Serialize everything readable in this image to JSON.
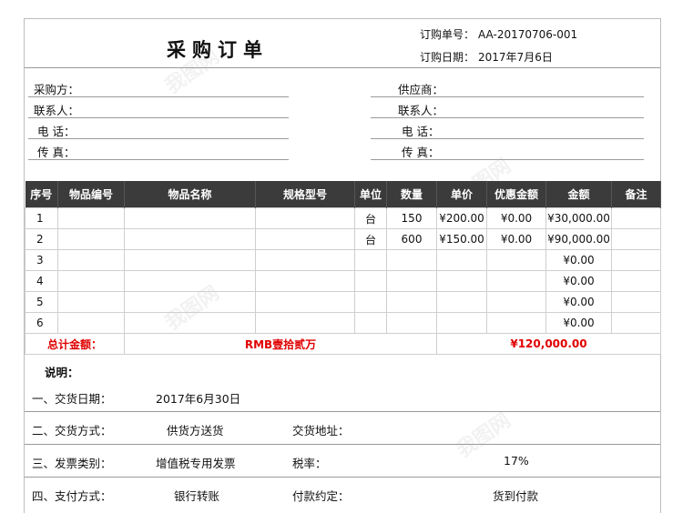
{
  "header": {
    "title": "采购订单",
    "order_no_label": "订购单号：",
    "order_no": "AA-20170706-001",
    "order_date_label": "订购日期：",
    "order_date": "2017年7月6日"
  },
  "parties": {
    "buyer_label": "采购方：",
    "buyer_contact_label": "联系人：",
    "buyer_phone_label": "电  话：",
    "buyer_fax_label": "传  真：",
    "supplier_label": "供应商：",
    "supplier_contact_label": "联系人：",
    "supplier_phone_label": "电  话：",
    "supplier_fax_label": "传  真："
  },
  "table": {
    "headers": [
      "序号",
      "物品编号",
      "物品名称",
      "规格型号",
      "单位",
      "数量",
      "单价",
      "优惠金额",
      "金额",
      "备注"
    ],
    "rows": [
      {
        "no": "1",
        "code": "",
        "name": "",
        "spec": "",
        "unit": "台",
        "qty": "150",
        "price": "¥200.00",
        "discount": "¥0.00",
        "amount": "¥30,000.00",
        "note": ""
      },
      {
        "no": "2",
        "code": "",
        "name": "",
        "spec": "",
        "unit": "台",
        "qty": "600",
        "price": "¥150.00",
        "discount": "¥0.00",
        "amount": "¥90,000.00",
        "note": ""
      },
      {
        "no": "3",
        "code": "",
        "name": "",
        "spec": "",
        "unit": "",
        "qty": "",
        "price": "",
        "discount": "",
        "amount": "¥0.00",
        "note": ""
      },
      {
        "no": "4",
        "code": "",
        "name": "",
        "spec": "",
        "unit": "",
        "qty": "",
        "price": "",
        "discount": "",
        "amount": "¥0.00",
        "note": ""
      },
      {
        "no": "5",
        "code": "",
        "name": "",
        "spec": "",
        "unit": "",
        "qty": "",
        "price": "",
        "discount": "",
        "amount": "¥0.00",
        "note": ""
      },
      {
        "no": "6",
        "code": "",
        "name": "",
        "spec": "",
        "unit": "",
        "qty": "",
        "price": "",
        "discount": "",
        "amount": "¥0.00",
        "note": ""
      }
    ],
    "total_label": "总计金额：",
    "total_words": "RMB壹拾贰万",
    "total_amount": "¥120,000.00"
  },
  "notes": {
    "title": "说明：",
    "delivery_date_label": "一、交货日期：",
    "delivery_date": "2017年6月30日",
    "delivery_method_label": "二、交货方式：",
    "delivery_method": "供货方送货",
    "delivery_address_label": "交货地址：",
    "invoice_type_label": "三、发票类别：",
    "invoice_type": "增值税专用发票",
    "tax_rate_label": "税率：",
    "tax_rate": "17%",
    "payment_method_label": "四、支付方式：",
    "payment_method": "银行转账",
    "payment_terms_label": "付款约定：",
    "payment_terms": "货到付款"
  },
  "colors": {
    "header_bg": "#3b3b3b",
    "total_red": "#e00000"
  }
}
